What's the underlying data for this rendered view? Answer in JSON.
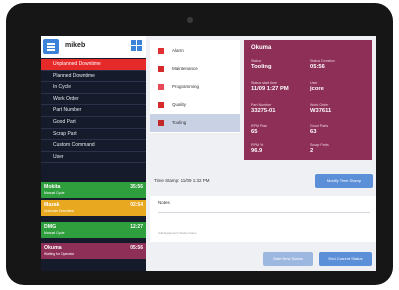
{
  "app": {
    "logo_text": "mikeb"
  },
  "menu": [
    {
      "label": "Unplanned Downtime",
      "active": true
    },
    {
      "label": "Planned Downtime",
      "active": false
    },
    {
      "label": "In Cycle",
      "active": false
    },
    {
      "label": "Work Order",
      "active": false
    },
    {
      "label": "Part Number",
      "active": false
    },
    {
      "label": "Good Part",
      "active": false
    },
    {
      "label": "Scrap Part",
      "active": false
    },
    {
      "label": "Custom Command",
      "active": false
    },
    {
      "label": "User",
      "active": false
    }
  ],
  "machines": [
    {
      "name": "Mokita",
      "status": "Manual Cycle",
      "time": "35:56",
      "color": "#2f9e3c"
    },
    {
      "name": "Mazak",
      "status": "Unknown Downtime",
      "time": "02:54",
      "color": "#e8a820"
    },
    {
      "name": "DMG",
      "status": "Manual Cycle",
      "time": "12:27",
      "color": "#2f9e3c"
    },
    {
      "name": "Okuma",
      "status": "Waiting for Operator",
      "time": "05:56",
      "color": "#8e2f58"
    }
  ],
  "states": [
    {
      "label": "Alarm",
      "color": "#e23030",
      "selected": false
    },
    {
      "label": "Maintenance",
      "color": "#d62a2a",
      "selected": false
    },
    {
      "label": "Programming",
      "color": "#e84a55",
      "selected": false
    },
    {
      "label": "Quality",
      "color": "#d62a2a",
      "selected": false
    },
    {
      "label": "Tooling",
      "color": "#c22a2a",
      "selected": true
    }
  ],
  "detail": {
    "title": "Okuma",
    "fields": [
      {
        "label": "Status",
        "value": "Tooling"
      },
      {
        "label": "Status Duration",
        "value": "05:56"
      },
      {
        "label": "Status start time",
        "value": "11/09 1:27 PM"
      },
      {
        "label": "User",
        "value": "jcore"
      },
      {
        "label": "Part Number",
        "value": "33275-01"
      },
      {
        "label": "Work Order",
        "value": "W37611"
      },
      {
        "label": "RPM Plan",
        "value": "65"
      },
      {
        "label": "Good Parts",
        "value": "63"
      },
      {
        "label": "RPM %",
        "value": "96.9"
      },
      {
        "label": "Scrap Parts",
        "value": "2"
      }
    ]
  },
  "time_stamp": "Time Stamp: 11/09 1:32 PM",
  "buttons": {
    "modify_time_stamp": "Modify Time Stamp",
    "start_new_status": "Start New Status",
    "end_current_status": "End Current Status"
  },
  "notes": {
    "label": "Notes",
    "placeholder": "Add Equipment Status Notes"
  }
}
